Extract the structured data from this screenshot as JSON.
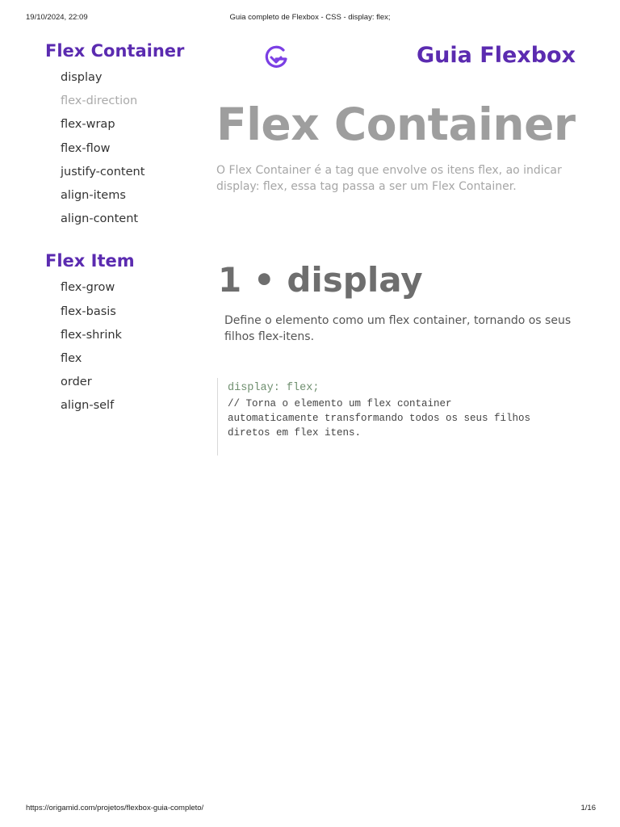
{
  "print": {
    "date": "19/10/2024, 22:09",
    "title": "Guia completo de Flexbox - CSS - display: flex;",
    "url": "https://origamid.com/projetos/flexbox-guia-completo/",
    "page": "1/16"
  },
  "sidebar": {
    "container_heading": "Flex Container",
    "container_items": [
      {
        "label": "display"
      },
      {
        "label": "flex-direction"
      },
      {
        "label": "flex-wrap"
      },
      {
        "label": "flex-flow"
      },
      {
        "label": "justify-content"
      },
      {
        "label": "align-items"
      },
      {
        "label": "align-content"
      }
    ],
    "item_heading": "Flex Item",
    "item_items": [
      {
        "label": "flex-grow"
      },
      {
        "label": "flex-basis"
      },
      {
        "label": "flex-shrink"
      },
      {
        "label": "flex"
      },
      {
        "label": "order"
      },
      {
        "label": "align-self"
      }
    ]
  },
  "header": {
    "logo_icon": "origamid-logo-icon",
    "brand": "Guia Flexbox",
    "brand_color": "#5b2bb0"
  },
  "main": {
    "title": "Flex Container",
    "description": "O Flex Container é a tag que envolve os itens flex, ao indicar display: flex, essa tag passa a ser um Flex Container.",
    "section_title": "1 • display",
    "section_description": "Define o elemento como um flex container, tornando os seus filhos flex-itens.",
    "code": "display: flex;",
    "code_comment": "// Torna o elemento um flex container\nautomaticamente transformando todos os seus filhos\ndiretos em flex itens."
  }
}
